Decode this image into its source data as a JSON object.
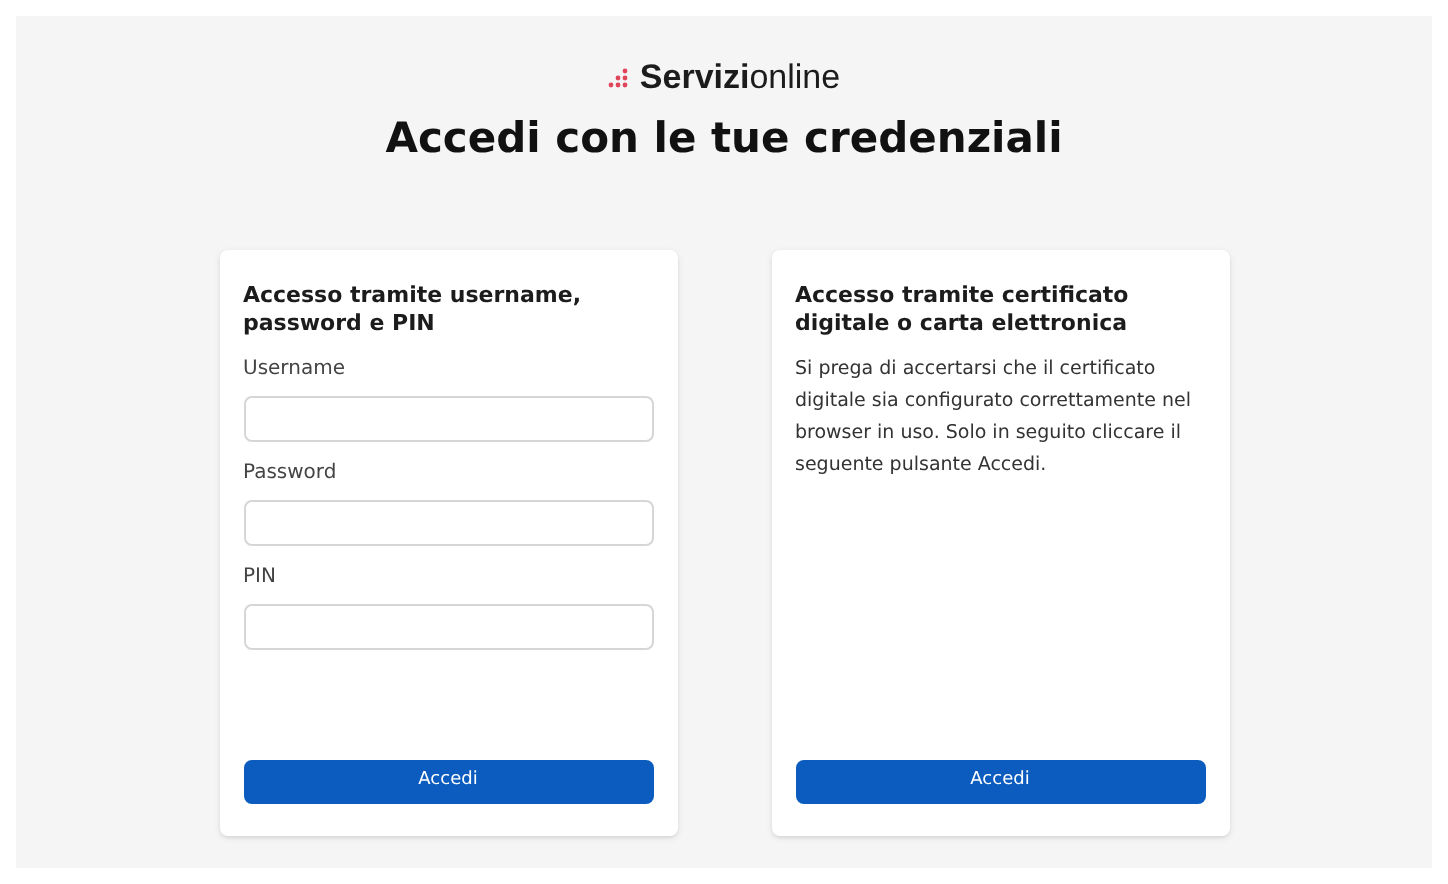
{
  "logo": {
    "text": "**Servizi**online"
  },
  "title": "Accedi con le tue credenziali",
  "cards": [
    {
      "kind": "form",
      "heading": "Accesso tramite username, password e PIN",
      "fields": [
        {
          "label": "Username"
        },
        {
          "label": "Password"
        },
        {
          "label": "PIN"
        }
      ],
      "button": "Accedi"
    },
    {
      "kind": "info",
      "heading": "Accesso tramite certificato digitale o carta elettronica",
      "text": "Si prega di accertarsi che il certificato digitale sia configurato correttamente nel browser in uso. Solo in seguito cliccare il seguente pulsante Accedi.",
      "button": "Accedi"
    }
  ]
}
